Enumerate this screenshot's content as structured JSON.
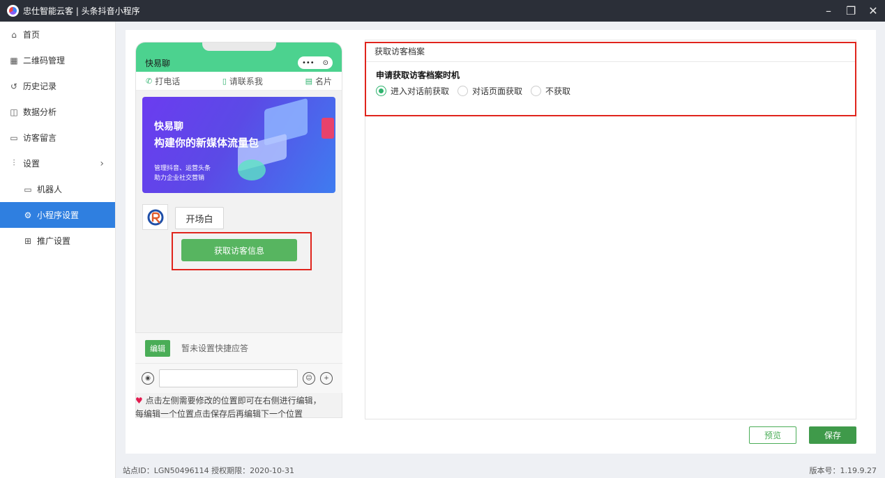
{
  "window": {
    "title": "忠仕智能云客 | 头条抖音小程序",
    "minimize": "–",
    "restore": "❐",
    "close": "✕"
  },
  "sidebar": {
    "items": [
      {
        "label": "首页",
        "icon": "home-icon"
      },
      {
        "label": "二维码管理",
        "icon": "qrcode-icon"
      },
      {
        "label": "历史记录",
        "icon": "history-icon"
      },
      {
        "label": "数据分析",
        "icon": "analytics-icon"
      },
      {
        "label": "访客留言",
        "icon": "message-icon"
      },
      {
        "label": "设置",
        "icon": "settings-sliders-icon"
      },
      {
        "label": "机器人",
        "icon": "robot-icon"
      },
      {
        "label": "小程序设置",
        "icon": "gear-icon"
      },
      {
        "label": "推广设置",
        "icon": "grid-icon"
      }
    ],
    "active": "小程序设置",
    "chevron": "›"
  },
  "phone": {
    "title": "快易聊",
    "capsule_dots": "•••",
    "capsule_target": "⊙",
    "actions": [
      {
        "icon": "phone-icon",
        "glyph": "✆",
        "label": "打电话"
      },
      {
        "icon": "mobile-icon",
        "glyph": "▯",
        "label": "请联系我"
      },
      {
        "icon": "card-icon",
        "glyph": "▤",
        "label": "名片"
      }
    ],
    "banner": {
      "line1": "快易聊",
      "line2": "构建你的新媒体流量包",
      "line3": "管理抖音、运营头条",
      "line4": "助力企业社交营销"
    },
    "opening_label": "开场白",
    "get_info_button": "获取访客信息",
    "edit_tag": "编辑",
    "no_quick_reply": "暂未设置快捷应答"
  },
  "hint": {
    "heart": "♥",
    "line1": " 点击左侧需要修改的位置即可在右侧进行编辑，",
    "line2": "每编辑一个位置点击保存后再编辑下一个位置"
  },
  "panel": {
    "title": "获取访客档案",
    "question": "申请获取访客档案时机",
    "options": [
      {
        "label": "进入对话前获取",
        "checked": true
      },
      {
        "label": "对话页面获取",
        "checked": false
      },
      {
        "label": "不获取",
        "checked": false
      }
    ]
  },
  "buttons": {
    "preview": "预览",
    "save": "保存"
  },
  "status": {
    "left": "站点ID：LGN50496114 授权期限：2020-10-31",
    "right": "版本号：1.19.9.27"
  },
  "colors": {
    "accent_blue": "#2f7fe0",
    "green": "#4aad57",
    "highlight_red": "#e0241c",
    "titlebar": "#2b2f38"
  }
}
